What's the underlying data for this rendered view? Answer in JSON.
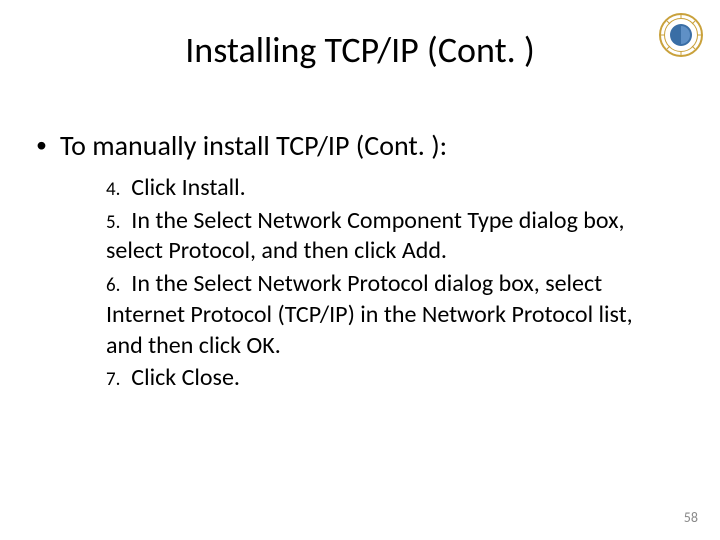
{
  "title": "Installing TCP/IP (Cont. )",
  "bullet": "To manually install TCP/IP (Cont. ):",
  "steps": [
    {
      "num": "4.",
      "text": "Click Install."
    },
    {
      "num": "5.",
      "text": "In the Select Network Component Type dialog box, select Protocol, and then click Add."
    },
    {
      "num": "6.",
      "text": "In the Select Network Protocol dialog box, select Internet Protocol (TCP/IP) in the Network Protocol list, and then click OK."
    },
    {
      "num": "7.",
      "text": "Click Close."
    }
  ],
  "page_number": "58"
}
